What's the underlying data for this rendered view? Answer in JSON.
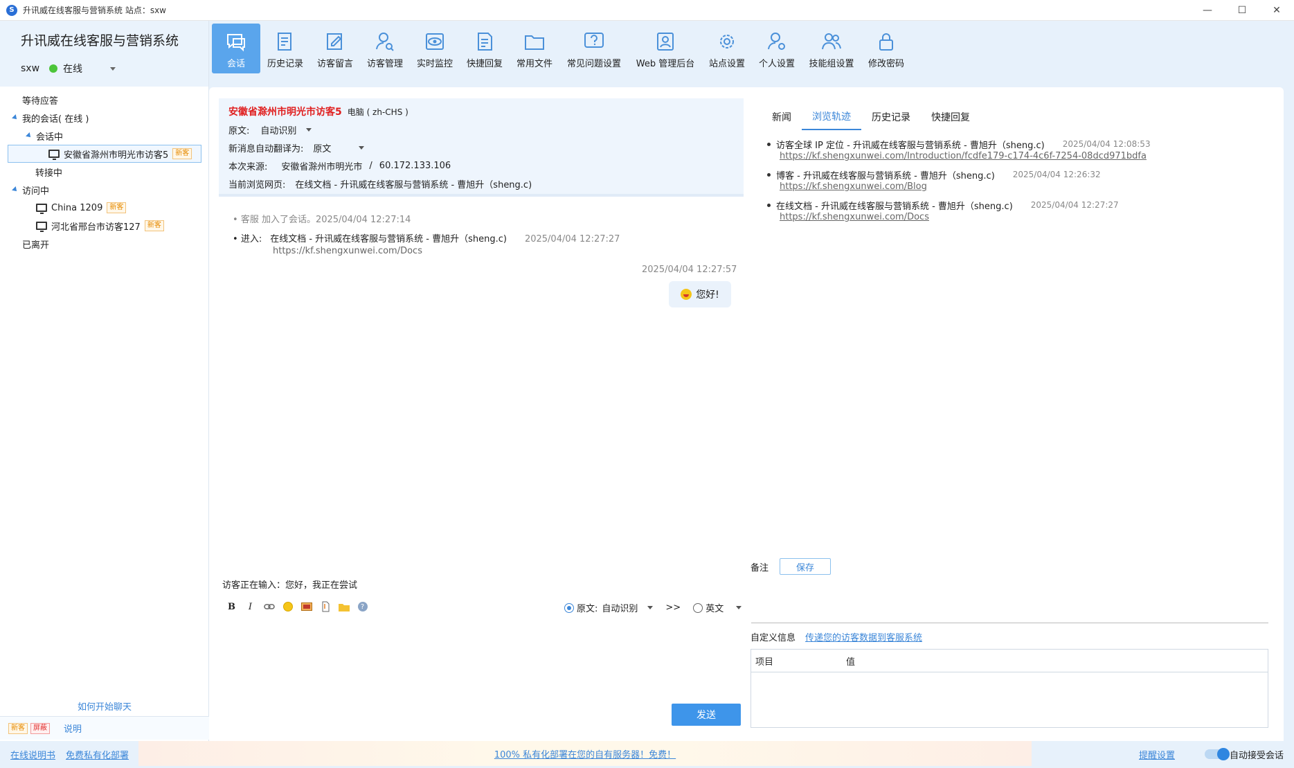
{
  "window": {
    "title": "升讯威在线客服与营销系统  站点：sxw",
    "controls": [
      "—",
      "☐",
      "✕"
    ]
  },
  "sidebar": {
    "brand": "升讯威在线客服与营销系统",
    "user": "sxw",
    "status": "在线",
    "tree": {
      "waiting": "等待应答",
      "my_sessions": "我的会话( 在线 )",
      "in_session": "会话中",
      "session_item": "安徽省滁州市明光市访客5",
      "transferring": "转接中",
      "visiting": "访问中",
      "visit_items": [
        "China 1209",
        "河北省邢台市访客127"
      ],
      "left": "已离开"
    },
    "badge_new": "新客",
    "badge_block": "屏蔽",
    "howto": "如何开始聊天",
    "legend_explain": "说明"
  },
  "toolbar": {
    "items": [
      "会话",
      "历史记录",
      "访客留言",
      "访客管理",
      "实时监控",
      "快捷回复",
      "常用文件",
      "常见问题设置",
      "Web 管理后台",
      "站点设置",
      "个人设置",
      "技能组设置",
      "修改密码"
    ]
  },
  "chat": {
    "visitor_name": "安徽省滁州市明光市访客5",
    "device": "电脑 ( zh-CHS )",
    "orig_label": "原文:",
    "orig_value": "自动识别",
    "auto_translate_label": "新消息自动翻译为:",
    "auto_translate_value": "原文",
    "source_label": "本次来源:",
    "source_value": "安徽省滁州市明光市",
    "source_sep": "/",
    "source_ip": "60.172.133.106",
    "current_page_label": "当前浏览网页:",
    "current_page_value": "在线文档 - 升讯威在线客服与营销系统 - 曹旭升（sheng.c)",
    "sys_msg": "客服 加入了会话。2025/04/04 12:27:14",
    "enter_label": "进入:",
    "enter_title": "在线文档 - 升讯威在线客服与营销系统 - 曹旭升（sheng.c)",
    "enter_time": "2025/04/04 12:27:27",
    "enter_url": "https://kf.shengxunwei.com/Docs",
    "msg_time": "2025/04/04 12:27:57",
    "msg_text": "您好!",
    "typing": "访客正在输入：您好，我正在尝试",
    "lang_orig": "原文:",
    "lang_auto": "自动识别",
    "lang_arrow": ">>",
    "lang_target": "英文",
    "send": "发送"
  },
  "right": {
    "tabs": [
      "新闻",
      "浏览轨迹",
      "历史记录",
      "快捷回复"
    ],
    "trail": [
      {
        "title": "访客全球 IP 定位 - 升讯威在线客服与营销系统 - 曹旭升（sheng.c)",
        "time": "2025/04/04 12:08:53",
        "url": "https://kf.shengxunwei.com/Introduction/fcdfe179-c174-4c6f-7254-08dcd971bdfa"
      },
      {
        "title": "博客 - 升讯威在线客服与营销系统 - 曹旭升（sheng.c)",
        "time": "2025/04/04 12:26:32",
        "url": "https://kf.shengxunwei.com/Blog"
      },
      {
        "title": "在线文档 - 升讯威在线客服与营销系统 - 曹旭升（sheng.c)",
        "time": "2025/04/04 12:27:27",
        "url": "https://kf.shengxunwei.com/Docs"
      }
    ],
    "remark_label": "备注",
    "save": "保存",
    "custom_label": "自定义信息",
    "custom_link": "传递您的访客数据到客服系统",
    "kv_item": "项目",
    "kv_value": "值"
  },
  "bottom": {
    "manual": "在线说明书",
    "private": "免费私有化部署",
    "promo": "100% 私有化部署在您的自有服务器！免费！",
    "remind": "提醒设置",
    "auto_accept": "自动接受会话"
  },
  "colors": {
    "accent": "#3b86d8",
    "active_tab": "#5aa5ec",
    "visitor_name": "#e02020",
    "online": "#4cc53a"
  }
}
